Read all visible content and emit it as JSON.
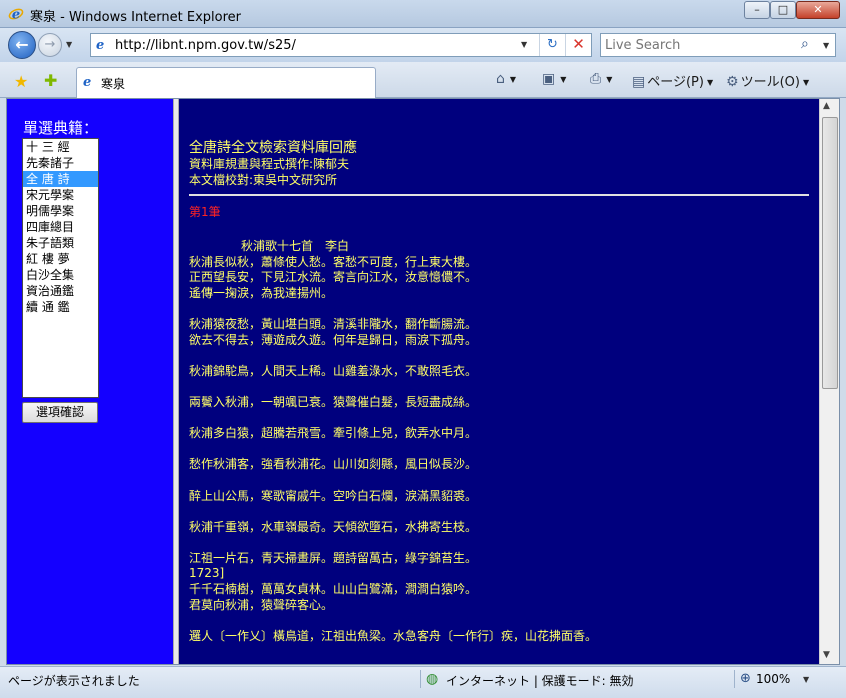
{
  "window": {
    "title": "寒泉 - Windows Internet Explorer",
    "min_glyph": "–",
    "max_glyph": "□",
    "close_glyph": "✕"
  },
  "address": {
    "url": "http://libnt.npm.gov.tw/s25/",
    "search_placeholder": "Live Search"
  },
  "tab": {
    "label": "寒泉"
  },
  "commands": {
    "page_label": "ページ(P)",
    "tools_label": "ツール(O)"
  },
  "sidebar": {
    "heading": "單選典籍：",
    "options": [
      "十 三 經",
      "先秦諸子",
      "全 唐 詩",
      "宋元學案",
      "明儒學案",
      "四庫總目",
      "朱子語類",
      "紅 樓 夢",
      "白沙全集",
      "資治通鑑",
      "續 通 鑑"
    ],
    "selected_index": 2,
    "confirm_label": "選項確認"
  },
  "main": {
    "title": "全唐詩全文檢索資料庫回應",
    "credit1": "資料庫規畫與程式撰作:陳郁夫",
    "credit2": "本文檔校對:東吳中文研究所",
    "record": "第1筆",
    "poem_title": "秋浦歌十七首　李白",
    "stanzas": [
      [
        "秋浦長似秋，蕭條使人愁。客愁不可度，行上東大樓。",
        "正西望長安，下見江水流。寄言向江水，汝意憶儂不。",
        "遙傳一掬淚，為我達揚州。"
      ],
      [
        "秋浦猿夜愁，黃山堪白頭。清溪非隴水，翻作斷腸流。",
        "欲去不得去，薄遊成久遊。何年是歸日，雨淚下孤舟。"
      ],
      [
        "秋浦錦駝鳥，人間天上稀。山雞羞淥水，不敢照毛衣。"
      ],
      [
        "兩鬢入秋浦，一朝颯已衰。猿聲催白髮，長短盡成絲。"
      ],
      [
        "秋浦多白猿，超騰若飛雪。牽引條上兒，飲弄水中月。"
      ],
      [
        "愁作秋浦客，強看秋浦花。山川如剡縣，風日似長沙。"
      ],
      [
        "醉上山公馬，寒歌甯戚牛。空吟白石爛，淚滿黑貂裘。"
      ],
      [
        "秋浦千重嶺，水車嶺最奇。天傾欲墮石，水拂寄生枝。"
      ],
      [
        "江祖一片石，青天掃畫屏。題詩留萬古，綠字錦苔生。",
        "1723]",
        "千千石楠樹，萬萬女貞林。山山白鷺滿，澗澗白猿吟。",
        "君莫向秋浦，猿聲碎客心。"
      ],
      [
        "邏人〔一作乂〕橫鳥道，江祖出魚梁。水急客舟〔一作行〕疾，山花拂面香。"
      ]
    ]
  },
  "status": {
    "text": "ページが表示されました",
    "zone": "インターネット | 保護モード: 無効",
    "zoom": "100%"
  },
  "colors": {
    "sidebar_bg": "#1400ff",
    "main_bg": "#00007e",
    "text_yellow": "#ffff66",
    "record_red": "#ff2222",
    "list_highlight": "#3399ff"
  },
  "icons": [
    "ie-logo-icon",
    "back-arrow-icon",
    "forward-arrow-icon",
    "page-icon",
    "refresh-icon",
    "stop-icon",
    "search-icon",
    "favorites-star-icon",
    "add-favorites-icon",
    "home-icon",
    "feeds-icon",
    "print-icon",
    "page-menu-icon",
    "tools-gear-icon",
    "globe-icon",
    "zoom-icon"
  ]
}
